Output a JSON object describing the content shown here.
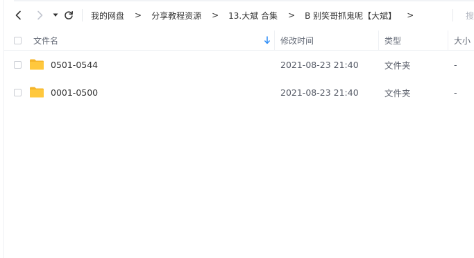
{
  "toolbar": {
    "back_icon": "chevron-left-icon",
    "forward_icon": "chevron-right-icon",
    "history_dropdown_icon": "caret-down-icon",
    "refresh_icon": "refresh-icon",
    "breadcrumb": [
      "我的网盘",
      "分享教程资源",
      "13.大斌 合集",
      "B 别笑哥抓鬼呢【大斌】"
    ],
    "separator": ">",
    "search_label": "搜索"
  },
  "table": {
    "headers": {
      "name": "文件名",
      "modified": "修改时间",
      "type": "类型",
      "size": "大小"
    },
    "sort_icon": "arrow-down-icon",
    "rows": [
      {
        "name": "0501-0544",
        "modified": "2021-08-23 21:40",
        "type": "文件夹",
        "size": "-"
      },
      {
        "name": "0001-0500",
        "modified": "2021-08-23 21:40",
        "type": "文件夹",
        "size": "-"
      }
    ]
  },
  "colors": {
    "folder": "#FFC83D",
    "folder_back": "#F5B52A",
    "sort_arrow": "#2b8cf7",
    "muted_text": "#b4b8c2"
  }
}
